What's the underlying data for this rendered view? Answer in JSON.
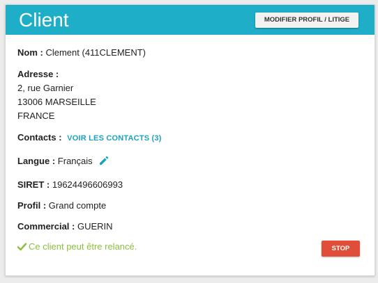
{
  "header": {
    "title": "Client",
    "profile_button_label": "MODIFIER PROFIL / LITIGE"
  },
  "fields": {
    "nom": {
      "label": "Nom :",
      "value": "Clement (411CLEMENT)"
    },
    "adresse": {
      "label": "Adresse :",
      "lines": [
        "2, rue Garnier",
        "13006 MARSEILLE",
        "FRANCE"
      ]
    },
    "contacts": {
      "label": "Contacts :",
      "link_label": "VOIR LES CONTACTS (3)"
    },
    "langue": {
      "label": "Langue :",
      "value": "Français",
      "edit_icon": "pencil-icon"
    },
    "siret": {
      "label": "SIRET :",
      "value": "19624496606993"
    },
    "profil": {
      "label": "Profil :",
      "value": "Grand compte"
    },
    "commercial": {
      "label": "Commercial :",
      "value": "GUERIN"
    }
  },
  "status": {
    "icon": "check-icon",
    "text": "Ce client peut être relancé.",
    "color": "#8dc03f"
  },
  "stop_button_label": "STOP",
  "colors": {
    "header_bg": "#1eaec8",
    "link": "#1aa3bf",
    "stop_button": "#e04e39",
    "page_bg": "#ececec"
  }
}
